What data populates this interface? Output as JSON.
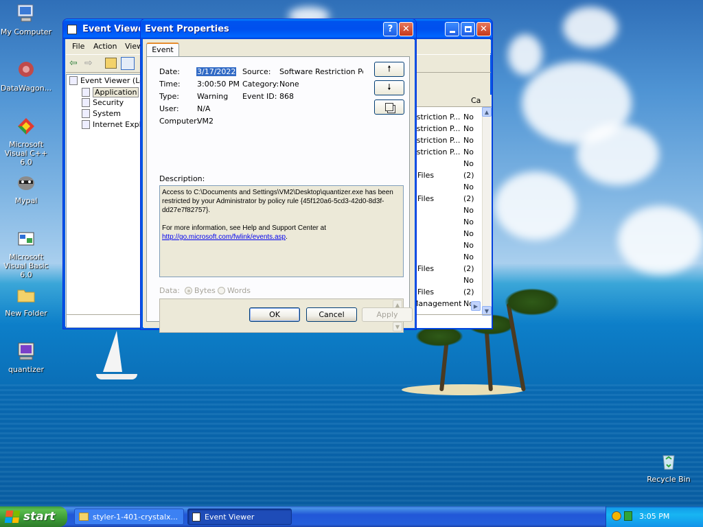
{
  "desktop": {
    "icons": [
      {
        "label": "My Computer"
      },
      {
        "label": "DataWagon..."
      },
      {
        "label": "Microsoft Visual C++ 6.0"
      },
      {
        "label": "Mypal"
      },
      {
        "label": "Microsoft Visual Basic 6.0"
      },
      {
        "label": "New Folder"
      },
      {
        "label": "quantizer"
      },
      {
        "label": "Recycle Bin"
      }
    ]
  },
  "event_viewer": {
    "title": "Event Viewer",
    "menu": [
      "File",
      "Action",
      "View"
    ],
    "tree": {
      "root": "Event Viewer (Loc",
      "items": [
        "Application",
        "Security",
        "System",
        "Internet Explo"
      ]
    },
    "list_header": "Ca",
    "rows": [
      {
        "c1": "estriction P...",
        "c2": "No"
      },
      {
        "c1": "estriction P...",
        "c2": "No"
      },
      {
        "c1": "estriction P...",
        "c2": "No"
      },
      {
        "c1": "estriction P...",
        "c2": "No"
      },
      {
        "c1": "",
        "c2": "No"
      },
      {
        "c1": "r Files",
        "c2": "(2)"
      },
      {
        "c1": "",
        "c2": "No"
      },
      {
        "c1": "r Files",
        "c2": "(2)"
      },
      {
        "c1": "",
        "c2": "No"
      },
      {
        "c1": "",
        "c2": "No"
      },
      {
        "c1": "",
        "c2": "No"
      },
      {
        "c1": "",
        "c2": "No"
      },
      {
        "c1": "",
        "c2": "No"
      },
      {
        "c1": "r Files",
        "c2": "(2)"
      },
      {
        "c1": "",
        "c2": "No"
      },
      {
        "c1": "r Files",
        "c2": "(2)"
      },
      {
        "c1": "Management",
        "c2": "No"
      }
    ]
  },
  "dialog": {
    "title": "Event Properties",
    "tab": "Event",
    "date_label": "Date:",
    "date": "3/17/2022",
    "time_label": "Time:",
    "time": "3:00:50 PM",
    "type_label": "Type:",
    "type": "Warning",
    "user_label": "User:",
    "user": "N/A",
    "computer_label": "Computer:",
    "computer": "VM2",
    "source_label": "Source:",
    "source": "Software Restriction Polic",
    "category_label": "Category:",
    "category": "None",
    "eventid_label": "Event ID:",
    "eventid": "868",
    "description_label": "Description:",
    "description_text": "Access to C:\\Documents and Settings\\VM2\\Desktop\\quantizer.exe has been restricted by your Administrator by policy rule {45f120a6-5cd3-42d0-8d3f-dd27e7f82757}.",
    "description_more": "For more information, see Help and Support Center at",
    "description_link": "http://go.microsoft.com/fwlink/events.asp",
    "description_end": ".",
    "data_label": "Data:",
    "bytes_label": "Bytes",
    "words_label": "Words",
    "ok": "OK",
    "cancel": "Cancel",
    "apply": "Apply"
  },
  "taskbar": {
    "start": "start",
    "tasks": [
      "styler-1-401-crystalx...",
      "Event Viewer"
    ],
    "clock": "3:05 PM"
  }
}
